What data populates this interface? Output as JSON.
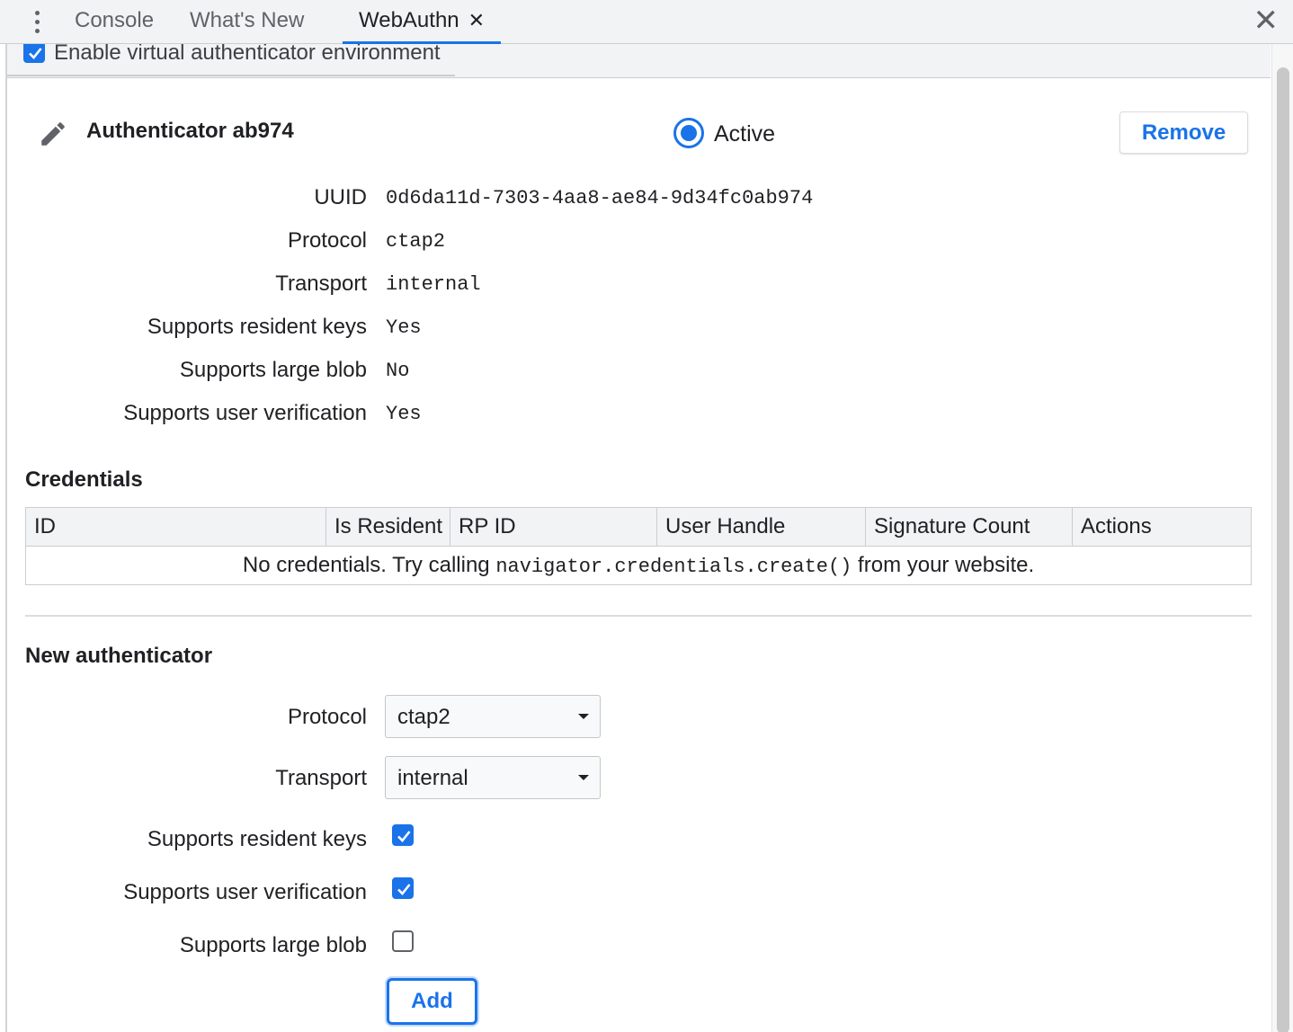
{
  "tabs": [
    {
      "label": "Console",
      "active": false
    },
    {
      "label": "What's New",
      "active": false
    },
    {
      "label": "WebAuthn",
      "active": true,
      "closable": true
    }
  ],
  "toolbar": {
    "enable_label": "Enable virtual authenticator environment",
    "enable_checked": true
  },
  "authenticator": {
    "name": "Authenticator ab974",
    "active_label": "Active",
    "active": true,
    "remove_label": "Remove",
    "properties": [
      {
        "label": "UUID",
        "value": "0d6da11d-7303-4aa8-ae84-9d34fc0ab974"
      },
      {
        "label": "Protocol",
        "value": "ctap2"
      },
      {
        "label": "Transport",
        "value": "internal"
      },
      {
        "label": "Supports resident keys",
        "value": "Yes"
      },
      {
        "label": "Supports large blob",
        "value": "No"
      },
      {
        "label": "Supports user verification",
        "value": "Yes"
      }
    ]
  },
  "credentials": {
    "title": "Credentials",
    "columns": [
      "ID",
      "Is Resident",
      "RP ID",
      "User Handle",
      "Signature Count",
      "Actions"
    ],
    "empty_prefix": "No credentials. Try calling ",
    "empty_code": "navigator.credentials.create()",
    "empty_suffix": " from your website."
  },
  "new_authenticator": {
    "title": "New authenticator",
    "protocol_label": "Protocol",
    "protocol_value": "ctap2",
    "transport_label": "Transport",
    "transport_value": "internal",
    "resident_keys_label": "Supports resident keys",
    "resident_keys_checked": true,
    "user_verification_label": "Supports user verification",
    "user_verification_checked": true,
    "large_blob_label": "Supports large blob",
    "large_blob_checked": false,
    "add_label": "Add"
  },
  "icons": {
    "menu": "more-vertical-icon",
    "close_tab": "close-icon",
    "close_panel": "close-icon",
    "edit": "pencil-icon"
  },
  "colors": {
    "accent": "#1a73e8",
    "tabbar_bg": "#f1f3f4",
    "border": "#cbcdd1"
  }
}
